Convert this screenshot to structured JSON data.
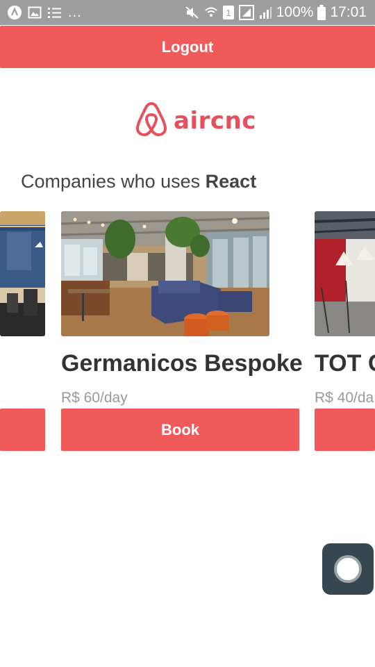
{
  "status_bar": {
    "left_icons": [
      "app-icon",
      "image-icon",
      "list-icon"
    ],
    "overflow": "...",
    "battery": "100%",
    "time": "17:01",
    "sim_badge": "1"
  },
  "header": {
    "logout_label": "Logout"
  },
  "logo": {
    "text": "aircnc"
  },
  "heading": {
    "prefix": "Companies who uses ",
    "tech": "React"
  },
  "spots": [
    {
      "name": "",
      "price": "",
      "book_label": ""
    },
    {
      "name": "Germanicos Bespoke",
      "price": "R$ 60/day",
      "book_label": "Book"
    },
    {
      "name": "TOT C",
      "price": "R$ 40/da",
      "book_label": ""
    }
  ],
  "colors": {
    "accent": "#f05a5b",
    "brand": "#e6505b",
    "status_bar": "#9e9e9e"
  }
}
